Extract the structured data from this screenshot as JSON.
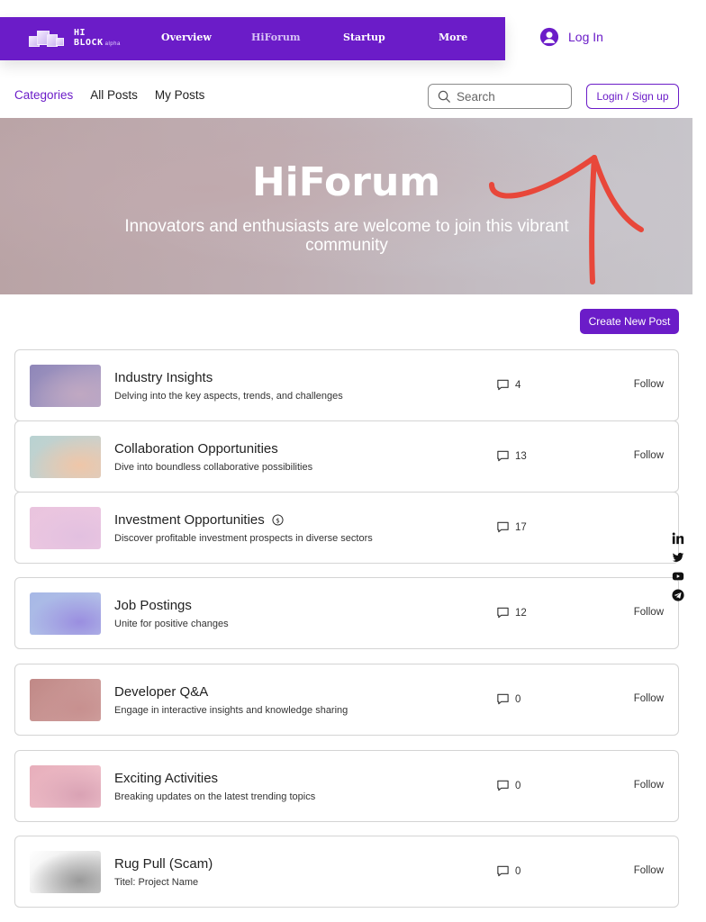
{
  "brand": {
    "line1": "HI",
    "line2": "BLOCK",
    "tag": "alpha"
  },
  "nav": {
    "items": [
      "Overview",
      "HiForum",
      "Startup",
      "More"
    ],
    "active": "HiForum"
  },
  "login": {
    "label": "Log In"
  },
  "subnav": {
    "tabs": [
      "Categories",
      "All Posts",
      "My Posts"
    ],
    "active": "Categories"
  },
  "search": {
    "placeholder": "Search",
    "value": ""
  },
  "auth": {
    "label": "Login / Sign up"
  },
  "hero": {
    "title": "HiForum",
    "subtitle": "Innovators and enthusiasts are welcome to join this vibrant community"
  },
  "create": {
    "label": "Create New Post"
  },
  "colors": {
    "accent": "#6b1cc8",
    "annotation": "#e8473a"
  },
  "categories": [
    {
      "title": "Industry Insights",
      "desc": "Delving into the key aspects, trends, and challenges",
      "comments": "4",
      "follow": "Follow",
      "coin": false,
      "thumb": [
        "#8e86b8",
        "#b7a8c8",
        "#c0a8c2"
      ]
    },
    {
      "title": "Collaboration Opportunities",
      "desc": "Dive into boundless collaborative possibilities",
      "comments": "13",
      "follow": "Follow",
      "coin": false,
      "thumb": [
        "#b8d2d2",
        "#d9cfc5",
        "#efc6a8"
      ]
    },
    {
      "title": "Investment Opportunities",
      "desc": "Discover profitable investment prospects in diverse sectors",
      "comments": "17",
      "follow": "",
      "coin": true,
      "thumb": [
        "#e9c4de",
        "#ecc8e2",
        "#e2c0e0"
      ]
    },
    {
      "title": "Job Postings",
      "desc": "Unite for positive changes",
      "comments": "12",
      "follow": "Follow",
      "coin": false,
      "thumb": [
        "#a7b8e6",
        "#b7c2e8",
        "#9a8ee0"
      ]
    },
    {
      "title": "Developer Q&A",
      "desc": "Engage in interactive insights and knowledge sharing",
      "comments": "0",
      "follow": "Follow",
      "coin": false,
      "thumb": [
        "#c08886",
        "#d3a6a4",
        "#c7908f"
      ]
    },
    {
      "title": "Exciting Activities",
      "desc": "Breaking updates on the latest trending topics",
      "comments": "0",
      "follow": "Follow",
      "coin": false,
      "thumb": [
        "#e7aebb",
        "#f1c6cf",
        "#d9a2b4"
      ]
    },
    {
      "title": "Rug Pull (Scam)",
      "desc": "Titel: Project Name",
      "comments": "0",
      "follow": "Follow",
      "coin": false,
      "thumb": [
        "#ffffff",
        "#d4d4d4",
        "#9a9a9a"
      ]
    }
  ],
  "social": [
    "linkedin-icon",
    "twitter-icon",
    "youtube-icon",
    "telegram-icon"
  ]
}
